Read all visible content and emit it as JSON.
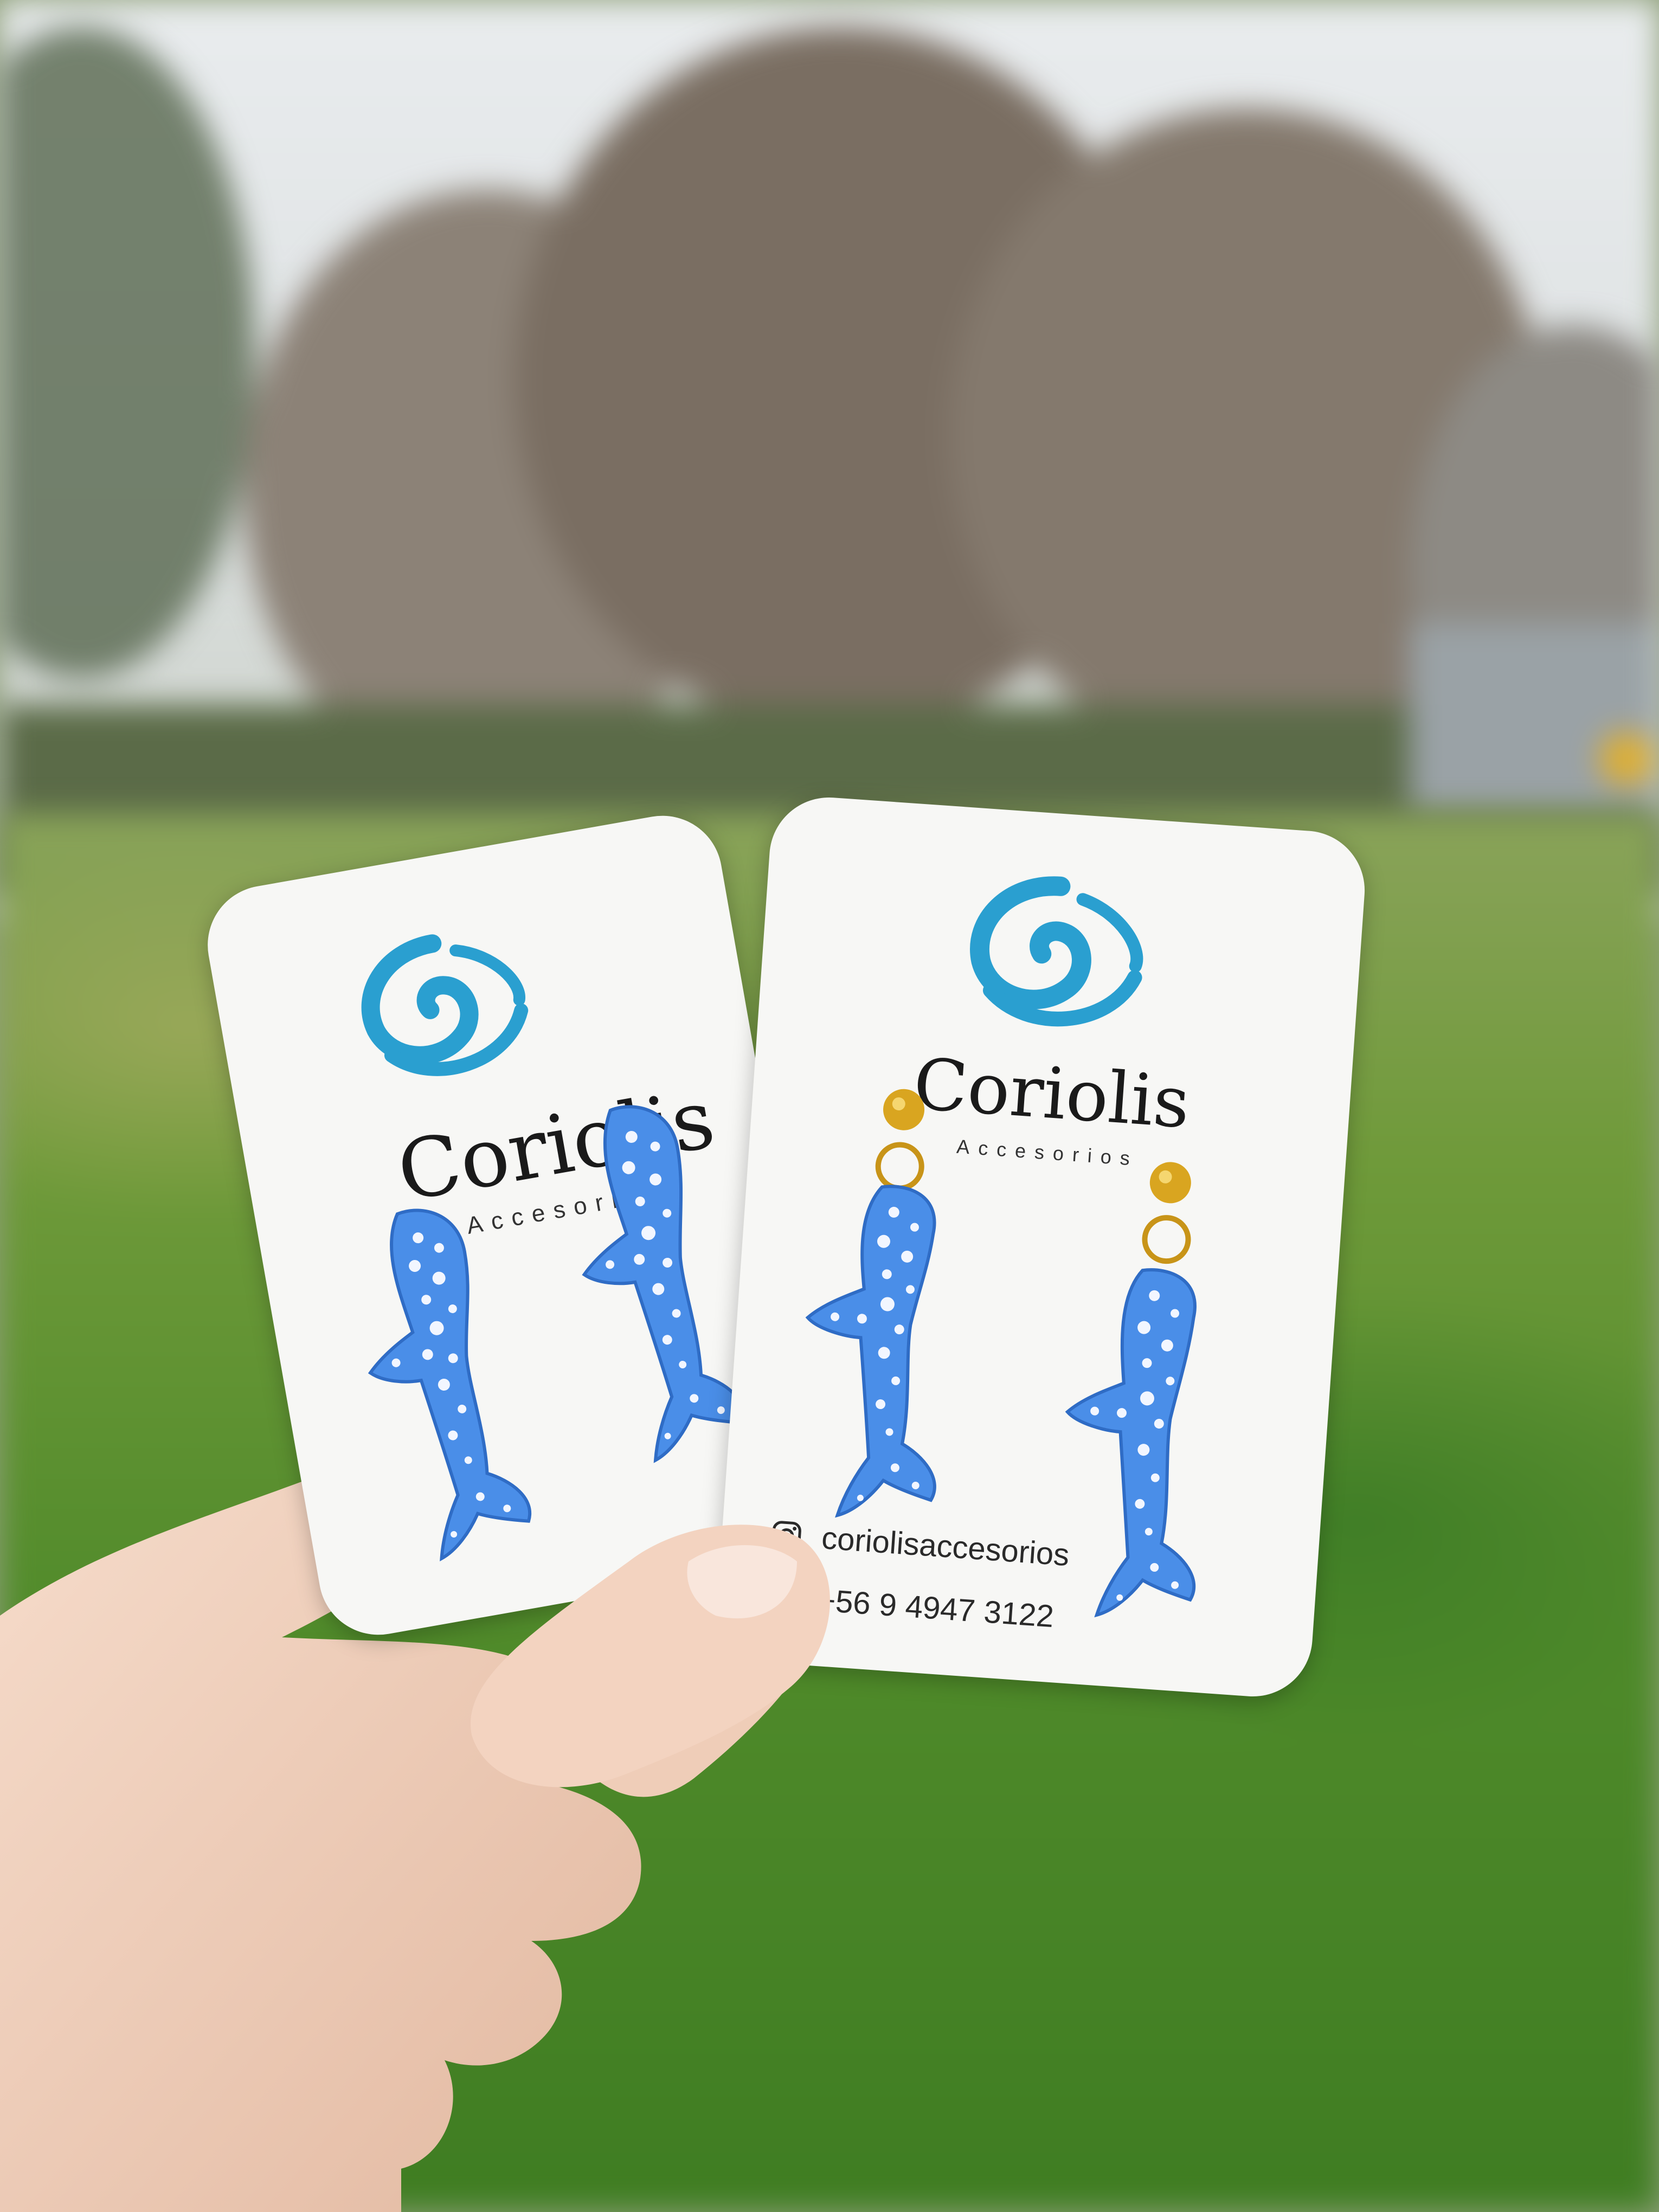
{
  "cards": [
    {
      "brand": "Coriolis",
      "subtitle": "Accesorios"
    },
    {
      "brand": "Coriolis",
      "subtitle": "Accesorios",
      "instagram": "coriolisaccesorios",
      "phone": "+56 9 4947 3122"
    }
  ],
  "colors": {
    "logo_blue": "#2a9fd0",
    "shark_blue": "#4a8ee8",
    "shark_spots": "#f2f6ff",
    "card": "#f7f7f5",
    "gold": "#d9a520"
  },
  "icons": [
    "wave-logo-icon",
    "instagram-icon",
    "whatsapp-icon"
  ]
}
